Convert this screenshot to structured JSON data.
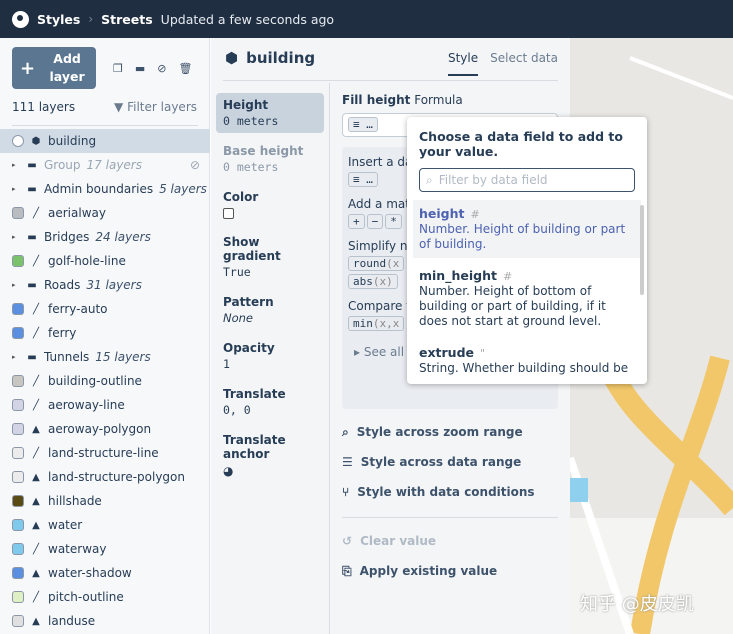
{
  "header": {
    "breadcrumb_root": "Styles",
    "breadcrumb_style": "Streets",
    "status": "Updated a few seconds ago"
  },
  "sidebar": {
    "add_label": "Add layer",
    "layer_count": "111 layers",
    "filter_label": "Filter layers",
    "layers": [
      {
        "name": "building",
        "type": "extrusion",
        "selected": true
      },
      {
        "name": "Group",
        "count": "17 layers",
        "type": "group",
        "hidden": true
      },
      {
        "name": "Admin boundaries",
        "count": "5 layers",
        "type": "group"
      },
      {
        "name": "aerialway",
        "type": "line",
        "color": "#b9bcc1"
      },
      {
        "name": "Bridges",
        "count": "24 layers",
        "type": "group"
      },
      {
        "name": "golf-hole-line",
        "type": "line",
        "color": "#7cc26a"
      },
      {
        "name": "Roads",
        "count": "31 layers",
        "type": "group"
      },
      {
        "name": "ferry-auto",
        "type": "line",
        "color": "#5b8fe0"
      },
      {
        "name": "ferry",
        "type": "line",
        "color": "#5b8fe0"
      },
      {
        "name": "Tunnels",
        "count": "15 layers",
        "type": "group"
      },
      {
        "name": "building-outline",
        "type": "line",
        "color": "#c8c6c3"
      },
      {
        "name": "aeroway-line",
        "type": "line",
        "color": "#d3d3e6"
      },
      {
        "name": "aeroway-polygon",
        "type": "fill",
        "color": "#d3d3e6"
      },
      {
        "name": "land-structure-line",
        "type": "line",
        "color": "#ececec"
      },
      {
        "name": "land-structure-polygon",
        "type": "fill",
        "color": "#ececec"
      },
      {
        "name": "hillshade",
        "type": "fill",
        "color": "#5a4a14"
      },
      {
        "name": "water",
        "type": "fill",
        "color": "#7fc9ec"
      },
      {
        "name": "waterway",
        "type": "line",
        "color": "#7fc9ec"
      },
      {
        "name": "water-shadow",
        "type": "fill",
        "color": "#5b8fe0"
      },
      {
        "name": "pitch-outline",
        "type": "line",
        "color": "#dff0c4"
      },
      {
        "name": "landuse",
        "type": "fill",
        "color": "#e0e0e0"
      }
    ]
  },
  "panel": {
    "title": "building",
    "tab_style": "Style",
    "tab_data": "Select data",
    "props": [
      {
        "name": "Height",
        "value": "0 meters"
      },
      {
        "name": "Base height",
        "value": "0 meters"
      },
      {
        "name": "Color",
        "value": ""
      },
      {
        "name": "Show gradient",
        "value": "True"
      },
      {
        "name": "Pattern",
        "value": "None"
      },
      {
        "name": "Opacity",
        "value": "1"
      },
      {
        "name": "Translate",
        "value": "0, 0"
      },
      {
        "name": "Translate anchor",
        "value": ""
      }
    ],
    "editor": {
      "label": "Fill height",
      "mode": "Formula",
      "insert": "Insert a data field",
      "math": "Add a math operator",
      "simplify": "Simplify numbers",
      "compare": "Compare two numbers",
      "see_all": "See all formula options",
      "ops": [
        "+",
        "−",
        "*"
      ],
      "round": "round",
      "round_arg": "(x",
      "abs": "abs",
      "abs_arg": "(x)",
      "min": "min",
      "min_arg": "(x,x"
    },
    "actions": [
      "Style across zoom range",
      "Style across data range",
      "Style with data conditions"
    ],
    "clear": "Clear value",
    "apply": "Apply existing value"
  },
  "popover": {
    "title": "Choose a data field to add to your value.",
    "filter_placeholder": "Filter by data field",
    "fields": [
      {
        "name": "height",
        "type": "#",
        "desc": "Number. Height of building or part of building."
      },
      {
        "name": "min_height",
        "type": "#",
        "desc": "Number. Height of bottom of building or part of building, if it does not start at ground level."
      },
      {
        "name": "extrude",
        "type": "\"",
        "desc": "String. Whether building should be"
      }
    ]
  },
  "watermark": "知乎 @皮皮凯"
}
